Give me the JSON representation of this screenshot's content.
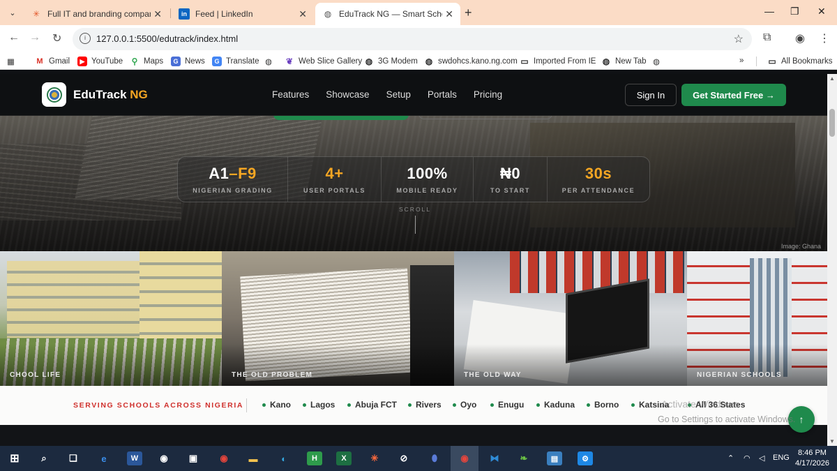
{
  "browser": {
    "tabs": [
      {
        "title": "Full IT and branding company w",
        "icon": "asterisk-favicon-icon"
      },
      {
        "title": "Feed | LinkedIn",
        "icon": "linkedin-icon"
      },
      {
        "title": "EduTrack NG — Smart School M",
        "icon": "globe-icon",
        "active": true
      }
    ],
    "url": "127.0.0.1:5500/edutrack/index.html",
    "bookmarks": [
      "Gmail",
      "YouTube",
      "Maps",
      "News",
      "Translate",
      "Web Slice Gallery",
      "3G Modem",
      "swdohcs.kano.ng.com",
      "Imported From IE",
      "New Tab"
    ],
    "all_bookmarks": "All Bookmarks"
  },
  "site": {
    "brand_main": "EduTrack",
    "brand_accent": "NG",
    "nav": [
      "Features",
      "Showcase",
      "Setup",
      "Portals",
      "Pricing"
    ],
    "sign_in": "Sign In",
    "cta": "Get Started Free →",
    "stats": [
      {
        "value_a": "A1",
        "value_b": "–F9",
        "label": "NIGERIAN GRADING"
      },
      {
        "value": "4+",
        "label": "USER PORTALS"
      },
      {
        "value": "100%",
        "label": "MOBILE READY"
      },
      {
        "value": "₦0",
        "label": "TO START"
      },
      {
        "value": "30s",
        "label": "PER ATTENDANCE"
      }
    ],
    "scroll_hint": "SCROLL",
    "image_credit": "Image: Ghana",
    "gallery": [
      "CHOOL LIFE",
      "THE OLD PROBLEM",
      "THE OLD WAY",
      "NIGERIAN SCHOOLS"
    ],
    "states_title": "SERVING SCHOOLS ACROSS NIGERIA",
    "states": [
      "Kano",
      "Lagos",
      "Abuja FCT",
      "Rivers",
      "Oyo",
      "Enugu",
      "Kaduna",
      "Borno",
      "Katsina",
      "All 36 States"
    ]
  },
  "watermark": {
    "line1": "Activate Windows",
    "line2": "Go to Settings to activate Windows."
  },
  "taskbar": {
    "lang": "ENG",
    "time": "8:46 PM",
    "date": "4/17/2026"
  },
  "colors": {
    "accent_gold": "#f5a623",
    "accent_green": "#1f8a4c",
    "states_red": "#d0312d",
    "tabstrip": "#fbdcc6"
  }
}
